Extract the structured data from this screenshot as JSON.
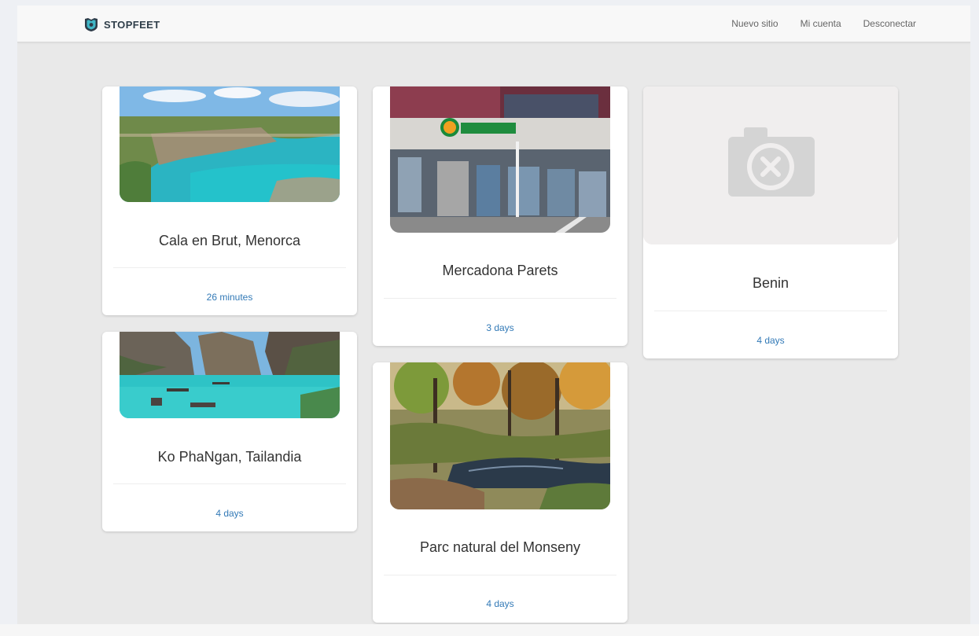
{
  "navbar": {
    "brand": "STOPFEET",
    "links": [
      "Nuevo sitio",
      "Mi cuenta",
      "Desconectar"
    ]
  },
  "cards": [
    {
      "title": "Cala en Brut, Menorca",
      "time": "26 minutes"
    },
    {
      "title": "Mercadona Parets",
      "time": "3 days"
    },
    {
      "title": "Benin",
      "time": "4 days"
    },
    {
      "title": "Ko PhaNgan, Tailandia",
      "time": "4 days"
    },
    {
      "title": "Parc natural del Monseny",
      "time": "4 days"
    }
  ],
  "colors": {
    "background": "#e9e9e9",
    "navbar": "#f8f8f8",
    "link": "#337ab7",
    "title": "#333333",
    "brand_logo": "#2a8a9a"
  }
}
